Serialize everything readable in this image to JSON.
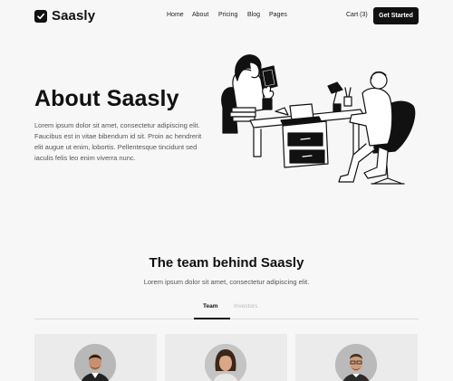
{
  "brand": {
    "name": "Saasly",
    "icon": "check-square-icon"
  },
  "nav": {
    "items": [
      {
        "label": "Home"
      },
      {
        "label": "About"
      },
      {
        "label": "Pricing"
      },
      {
        "label": "Blog"
      },
      {
        "label": "Pages"
      }
    ],
    "cart_label": "Cart (3)",
    "cta_label": "Get Started"
  },
  "hero": {
    "title": "About Saasly",
    "description": "Lorem ipsum dolor sit amet, consectetur adipiscing elit. Faucibus est in vitae bibendum id sit. Proin ac hendrerit elit augue ut enim, lobortis. Pellentesque tincidunt sed iaculis felis leo enim viverra nunc."
  },
  "team_section": {
    "title": "The team behind Saasly",
    "subtitle": "Lorem ipsum dolor sit amet, consectetur adipiscing elit.",
    "tabs": [
      {
        "label": "Team",
        "active": true
      },
      {
        "label": "Investors",
        "active": false
      }
    ]
  },
  "colors": {
    "accent": "#111111",
    "background": "#f7f7f7",
    "card": "#ebebeb"
  }
}
